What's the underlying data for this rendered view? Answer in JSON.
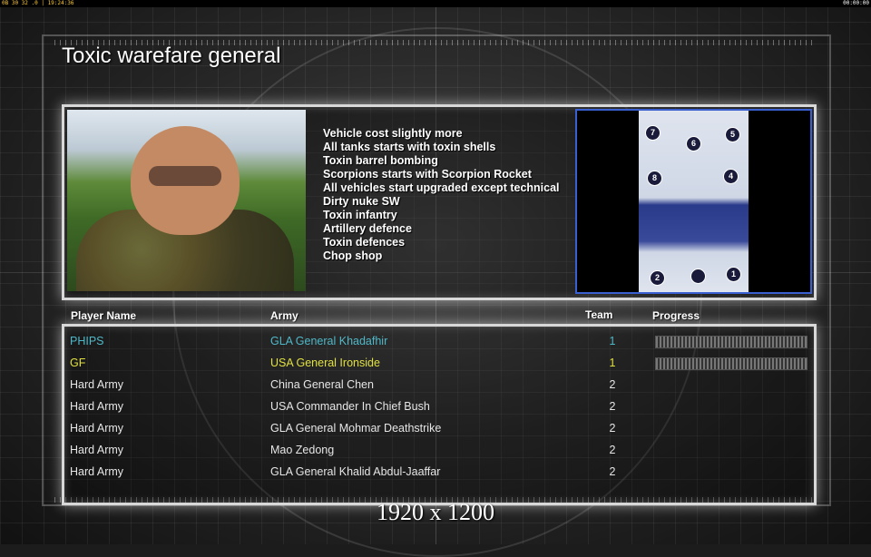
{
  "status_bar": {
    "left": "0B 30 32 .0 | 19:24:36",
    "right": "00:00:00"
  },
  "title": "Toxic warefare general",
  "features": [
    "Vehicle cost slightly more",
    "All tanks starts with toxin shells",
    "Toxin barrel bombing",
    "Scorpions starts with Scorpion Rocket",
    "All vehicles start upgraded except technical",
    "Dirty nuke SW",
    "Toxin infantry",
    "Artillery defence",
    "Toxin defences",
    "Chop shop"
  ],
  "map": {
    "slots": [
      "1",
      "2",
      "4",
      "5",
      "6",
      "7",
      "8"
    ]
  },
  "table": {
    "headers": {
      "player": "Player Name",
      "army": "Army",
      "team": "Team",
      "progress": "Progress"
    },
    "rows": [
      {
        "name": "PHIPS",
        "army": "GLA General Khadafhir",
        "team": "1",
        "color": "#4fb8c8",
        "progress": true
      },
      {
        "name": "GF",
        "army": "USA General Ironside",
        "team": "1",
        "color": "#e0e040",
        "progress": true
      },
      {
        "name": "Hard Army",
        "army": "China General Chen",
        "team": "2",
        "color": "#e6e6e6",
        "progress": false
      },
      {
        "name": "Hard Army",
        "army": "USA Commander In Chief Bush",
        "team": "2",
        "color": "#e6e6e6",
        "progress": false
      },
      {
        "name": "Hard Army",
        "army": "GLA General Mohmar Deathstrike",
        "team": "2",
        "color": "#e6e6e6",
        "progress": false
      },
      {
        "name": "Hard Army",
        "army": "Mao Zedong",
        "team": "2",
        "color": "#e6e6e6",
        "progress": false
      },
      {
        "name": "Hard Army",
        "army": "GLA General Khalid Abdul-Jaaffar",
        "team": "2",
        "color": "#e6e6e6",
        "progress": false
      }
    ]
  },
  "footer": "1920 x 1200"
}
